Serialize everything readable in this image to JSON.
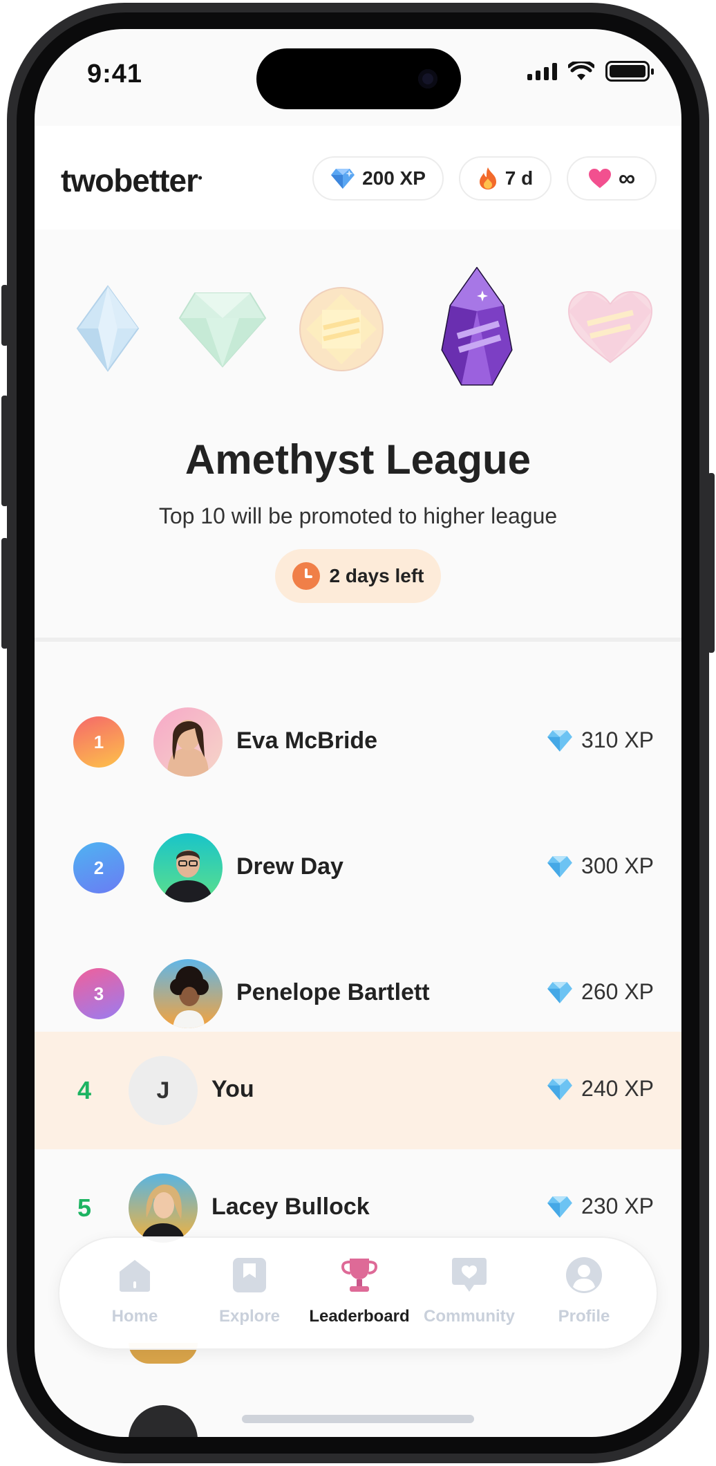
{
  "status_bar": {
    "time": "9:41"
  },
  "header": {
    "logo_text": "twobetter",
    "xp_pill": {
      "icon": "diamond-icon",
      "label": "200 XP"
    },
    "streak_pill": {
      "icon": "fire-icon",
      "label": "7 d"
    },
    "lives_pill": {
      "icon": "heart-icon",
      "label": "∞"
    }
  },
  "league": {
    "gems": [
      "diamond-gem",
      "emerald-gem",
      "topaz-gem",
      "amethyst-gem",
      "heart-gem"
    ],
    "title": "Amethyst League",
    "subtitle": "Top 10 will be promoted to higher league",
    "time_left": "2 days left"
  },
  "leaderboard": [
    {
      "rank": "1",
      "name": "Eva McBride",
      "xp": "310 XP"
    },
    {
      "rank": "2",
      "name": "Drew Day",
      "xp": "300 XP"
    },
    {
      "rank": "3",
      "name": "Penelope Bartlett",
      "xp": "260 XP"
    },
    {
      "rank": "4",
      "name": "You",
      "initial": "J",
      "xp": "240 XP"
    },
    {
      "rank": "5",
      "name": "Lacey Bullock",
      "xp": "230 XP"
    }
  ],
  "tabbar": {
    "tabs": [
      {
        "label": "Home",
        "icon": "home-icon"
      },
      {
        "label": "Explore",
        "icon": "bookmark-icon"
      },
      {
        "label": "Leaderboard",
        "icon": "trophy-icon",
        "active": true
      },
      {
        "label": "Community",
        "icon": "chat-heart-icon"
      },
      {
        "label": "Profile",
        "icon": "user-icon"
      }
    ]
  },
  "colors": {
    "accent_orange": "#f07f48",
    "you_row_bg": "#fdf0e4",
    "rank_green": "#1db462",
    "inactive_tab": "#c9d0db",
    "trophy_pink": "#d9608e"
  }
}
